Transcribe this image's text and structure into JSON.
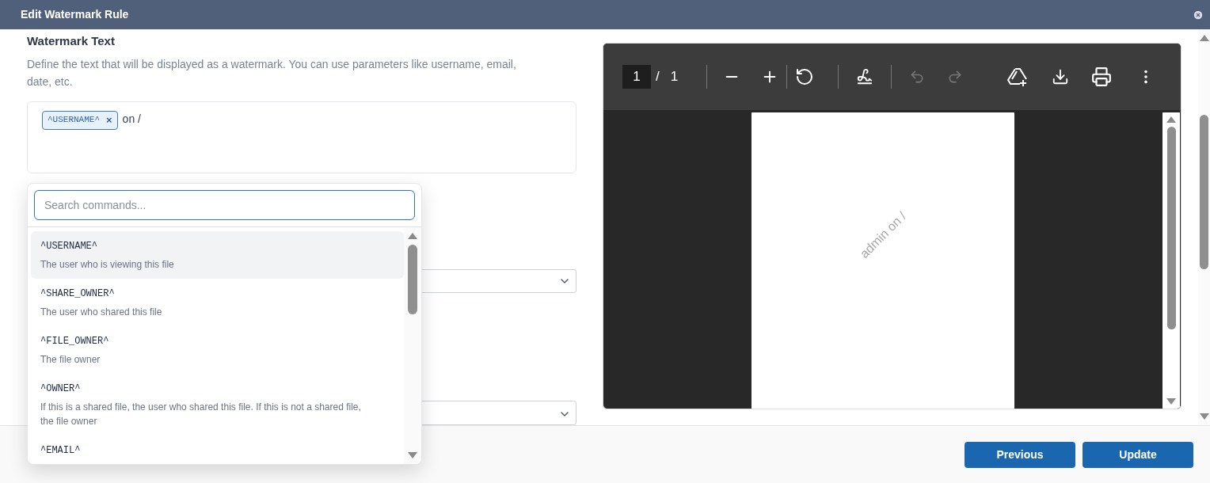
{
  "window": {
    "title": "Edit Watermark Rule"
  },
  "section": {
    "title": "Watermark Text",
    "description": "Define the text that will be displayed as a watermark. You can use parameters like username, email, date, etc."
  },
  "editor": {
    "tokens": [
      {
        "kind": "chip",
        "text": "^USERNAME^",
        "remove": "×"
      },
      {
        "kind": "text",
        "text": "on /"
      }
    ]
  },
  "command_menu": {
    "search": {
      "placeholder": "Search commands..."
    },
    "items": [
      {
        "code": "^USERNAME^",
        "description": "The user who is viewing this file",
        "selected": true
      },
      {
        "code": "^SHARE_OWNER^",
        "description": "The user who shared this file",
        "selected": false
      },
      {
        "code": "^FILE_OWNER^",
        "description": "The file owner",
        "selected": false
      },
      {
        "code": "^OWNER^",
        "description": "If this is a shared file, the user who shared this file. If this is not a shared file, the file owner",
        "selected": false
      },
      {
        "code": "^EMAIL^",
        "selected": false
      }
    ]
  },
  "viewer": {
    "page_input": "1",
    "page_separator": "/",
    "page_count": "1",
    "undo": {
      "disabled": true
    },
    "redo": {
      "disabled": true
    },
    "watermark_preview": "admin on /"
  },
  "buttons": [
    {
      "label": "Previous"
    },
    {
      "label": "Update"
    }
  ]
}
